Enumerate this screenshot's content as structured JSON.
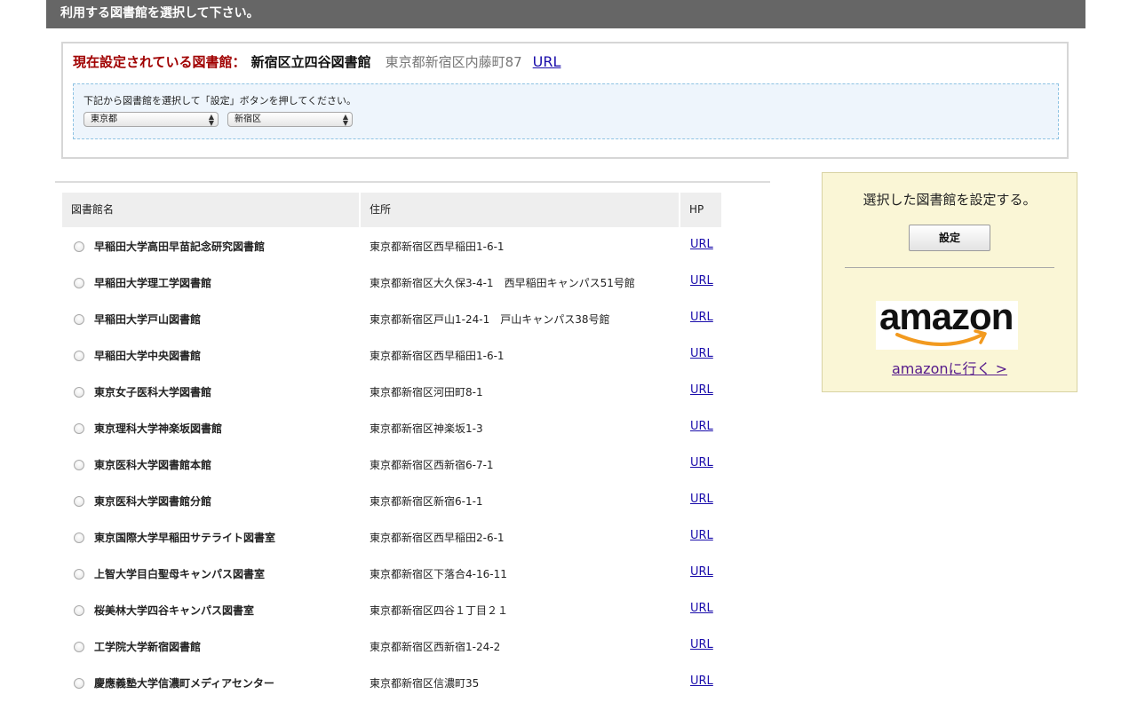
{
  "header": {
    "title": "利用する図書館を選択して下さい。"
  },
  "current": {
    "label": "現在設定されている図書館：",
    "name": "新宿区立四谷図書館",
    "address": "東京都新宿区内藤町87",
    "url_label": "URL"
  },
  "selector": {
    "instruction": "下記から図書館を選択して「設定」ボタンを押してください。",
    "prefecture": "東京都",
    "city": "新宿区"
  },
  "table": {
    "headers": {
      "name": "図書館名",
      "address": "住所",
      "hp": "HP"
    },
    "rows": [
      {
        "name": "早稲田大学高田早苗記念研究図書館",
        "address": "東京都新宿区西早稲田1-6-1",
        "url": "URL"
      },
      {
        "name": "早稲田大学理工学図書館",
        "address": "東京都新宿区大久保3-4-1　西早稲田キャンパス51号館",
        "url": "URL"
      },
      {
        "name": "早稲田大学戸山図書館",
        "address": "東京都新宿区戸山1-24-1　戸山キャンパス38号館",
        "url": "URL"
      },
      {
        "name": "早稲田大学中央図書館",
        "address": "東京都新宿区西早稲田1-6-1",
        "url": "URL"
      },
      {
        "name": "東京女子医科大学図書館",
        "address": "東京都新宿区河田町8-1",
        "url": "URL"
      },
      {
        "name": "東京理科大学神楽坂図書館",
        "address": "東京都新宿区神楽坂1-3",
        "url": "URL"
      },
      {
        "name": "東京医科大学図書館本館",
        "address": "東京都新宿区西新宿6-7-1",
        "url": "URL"
      },
      {
        "name": "東京医科大学図書館分館",
        "address": "東京都新宿区新宿6-1-1",
        "url": "URL"
      },
      {
        "name": "東京国際大学早稲田サテライト図書室",
        "address": "東京都新宿区西早稲田2-6-1",
        "url": "URL"
      },
      {
        "name": "上智大学目白聖母キャンパス図書室",
        "address": "東京都新宿区下落合4-16-11",
        "url": "URL"
      },
      {
        "name": "桜美林大学四谷キャンパス図書室",
        "address": "東京都新宿区四谷１丁目２１",
        "url": "URL"
      },
      {
        "name": "工学院大学新宿図書館",
        "address": "東京都新宿区西新宿1-24-2",
        "url": "URL"
      },
      {
        "name": "慶應義塾大学信濃町メディアセンター",
        "address": "東京都新宿区信濃町35",
        "url": "URL"
      }
    ]
  },
  "side": {
    "title": "選択した図書館を設定する。",
    "button": "設定",
    "logo_text": "amazon",
    "link": "amazonに行く >"
  }
}
